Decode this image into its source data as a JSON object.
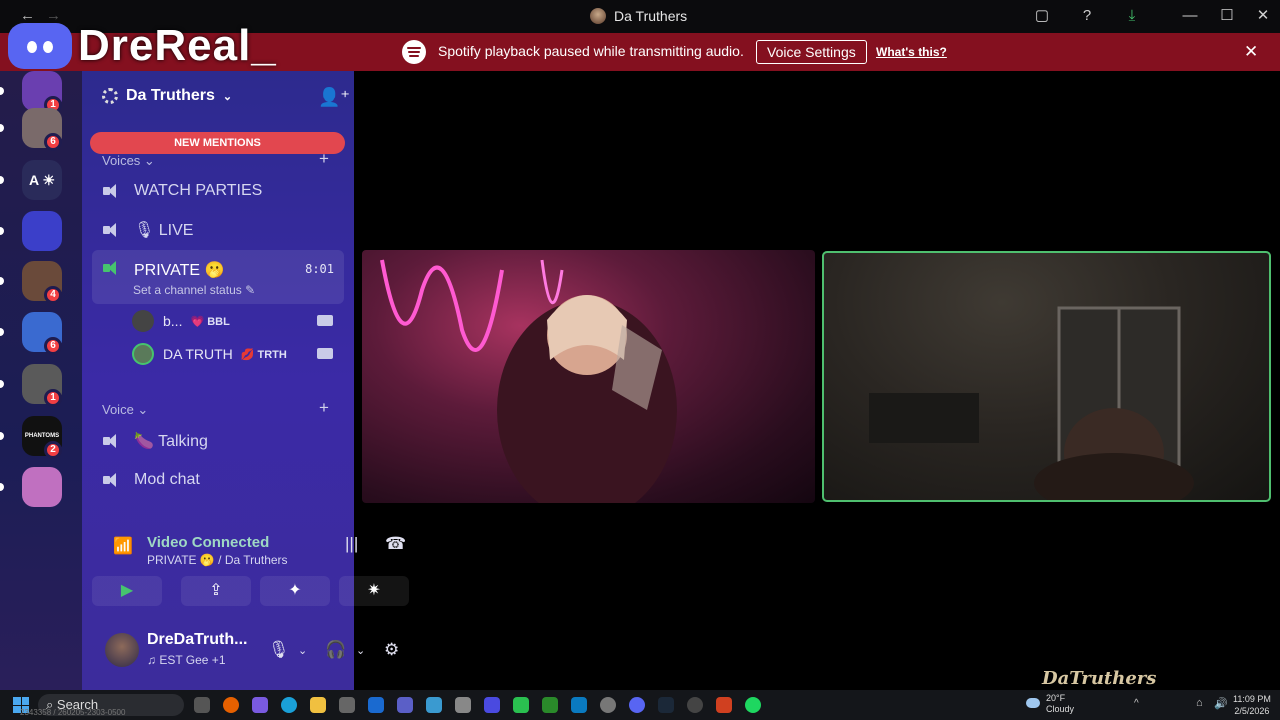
{
  "window": {
    "title": "Da Truthers",
    "back": "←",
    "forward": "→",
    "minimize": "—",
    "maximize": "☐",
    "close": "✕"
  },
  "notice": {
    "message": "Spotify playback paused while transmitting audio.",
    "button": "Voice Settings",
    "link": "What's this?"
  },
  "overlay": {
    "logo_text": "DreReal_",
    "watermark": "DaTruthers"
  },
  "servers": [
    {
      "badge": "1",
      "color": "#6a3fb0"
    },
    {
      "badge": "6",
      "color": "#7a6a6a"
    },
    {
      "label": "A ☀",
      "badge": "",
      "color": "#2a2b5a"
    },
    {
      "badge": "",
      "color": "#3b3fc9"
    },
    {
      "badge": "4",
      "color": "#6a4a3a"
    },
    {
      "badge": "6",
      "color": "#3a6ad0"
    },
    {
      "badge": "1",
      "color": "#5a5a5a"
    },
    {
      "label": "PHANTOMS",
      "badge": "2",
      "color": "#111111"
    },
    {
      "badge": "",
      "color": "#c070c0"
    }
  ],
  "sidebar": {
    "server_name": "Da Truthers",
    "new_mentions": "NEW MENTIONS",
    "categories": {
      "voices": "Voices",
      "voice": "Voice"
    },
    "channels": {
      "watch_parties": "WATCH PARTIES",
      "live": "🎙 LIVE",
      "private": "PRIVATE 🫢",
      "private_time": "8:01",
      "private_status": "Set a channel status",
      "talking": "🍆 Talking",
      "mod_chat": "Mod chat"
    },
    "members": [
      {
        "name": "b...",
        "tag": "💗 BBL"
      },
      {
        "name": "DA TRUTH",
        "tag": "💋 TRTH"
      }
    ]
  },
  "voice_panel": {
    "title": "Video Connected",
    "subtitle": "PRIVATE 🫢 / Da Truthers",
    "user_name": "DreDaTruth...",
    "user_status": "♫ EST Gee +1"
  },
  "taskbar": {
    "search": "Search",
    "build": "2343358 / 260205-2303-0500",
    "weather_temp": "20°F",
    "weather_cond": "Cloudy",
    "time": "11:09 PM",
    "date": "2/5/2026"
  },
  "colors": {
    "notice_bg": "#84101f",
    "speaking_border": "#4fbf6f",
    "mention_pill": "#e2474f",
    "accent_green": "#46c46e"
  }
}
